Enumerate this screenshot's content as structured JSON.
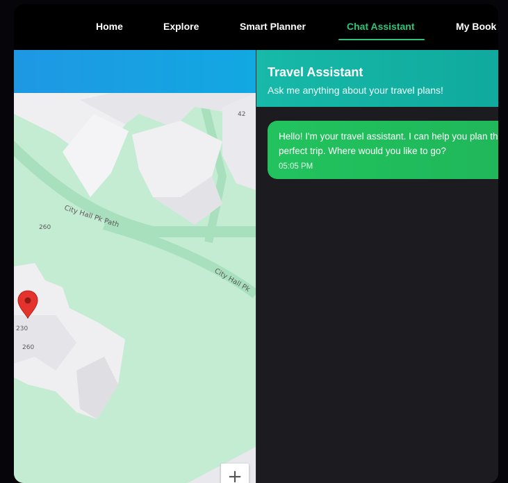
{
  "nav": {
    "items": [
      {
        "label": "Home"
      },
      {
        "label": "Explore"
      },
      {
        "label": "Smart Planner"
      },
      {
        "label": "Chat Assistant"
      },
      {
        "label": "My Book"
      }
    ],
    "active": "Chat Assistant"
  },
  "map": {
    "labels": {
      "num_42": "42",
      "num_260_a": "260",
      "num_230": "230",
      "num_260_b": "260",
      "street_1": "City Hall Pk Path",
      "street_2": "City Hall Pk"
    },
    "zoom_in_label": "+"
  },
  "chat": {
    "title": "Travel Assistant",
    "subtitle": "Ask me anything about your travel plans!",
    "messages": [
      {
        "text": "Hello! I'm your travel assistant. I can help you plan the perfect trip. Where would you like to go?",
        "time": "05:05 PM"
      }
    ]
  },
  "colors": {
    "accent": "#2ec47a",
    "map_header": "#1e98e3",
    "chat_header": "#17b9a8",
    "bubble": "#22c35e"
  }
}
